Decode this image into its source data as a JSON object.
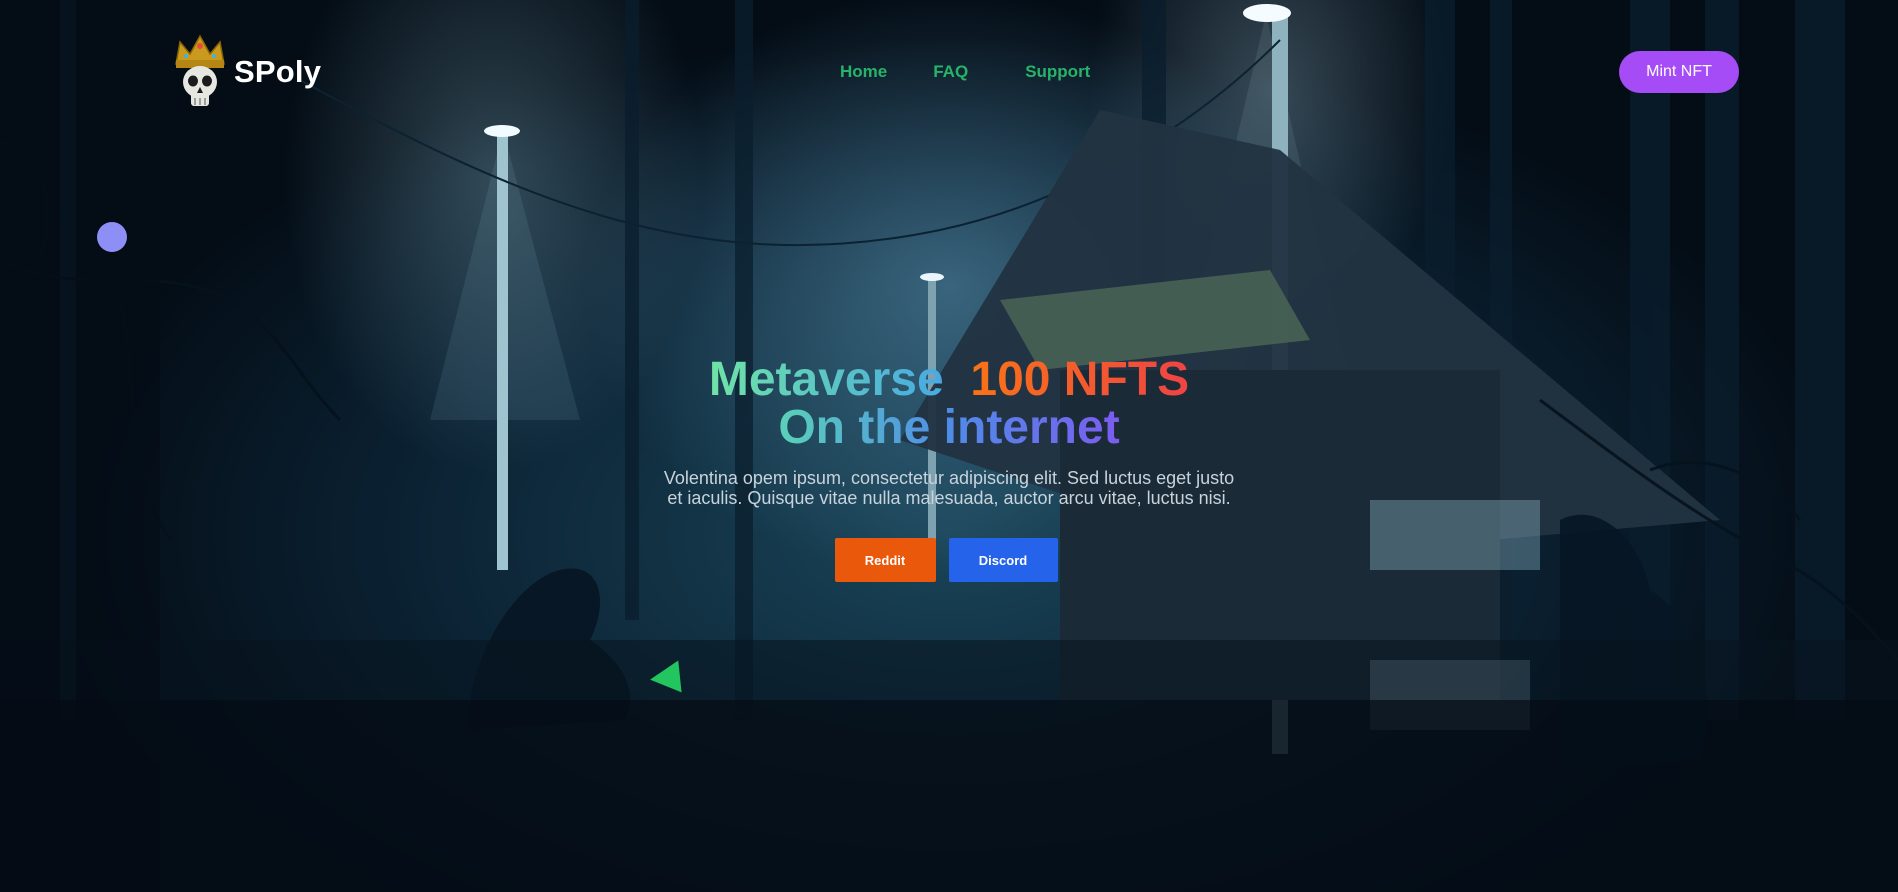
{
  "header": {
    "brand": "SPoly",
    "nav": [
      {
        "label": "Home"
      },
      {
        "label": "FAQ"
      },
      {
        "label": "Support"
      }
    ],
    "cta_label": "Mint NFT"
  },
  "hero": {
    "title_part1": "Metaverse",
    "title_part2": "100 NFTS",
    "title_line2": "On the internet",
    "description": "Volentina opem ipsum, consectetur adipiscing elit. Sed luctus eget justo et iaculis. Quisque vitae nulla malesuada, auctor arcu vitae, luctus nisi.",
    "buttons": [
      {
        "label": "Reddit",
        "color": "#ea580c"
      },
      {
        "label": "Discord",
        "color": "#2563eb"
      }
    ]
  },
  "colors": {
    "nav_link": "#27b36a",
    "mint_button": "#a64cf6",
    "dot": "#8d8ff6",
    "triangle": "#22c55e"
  },
  "icons": {
    "logo": "crowned-skull-icon",
    "decor_dot": "circle-shape",
    "decor_triangle": "triangle-shape"
  }
}
